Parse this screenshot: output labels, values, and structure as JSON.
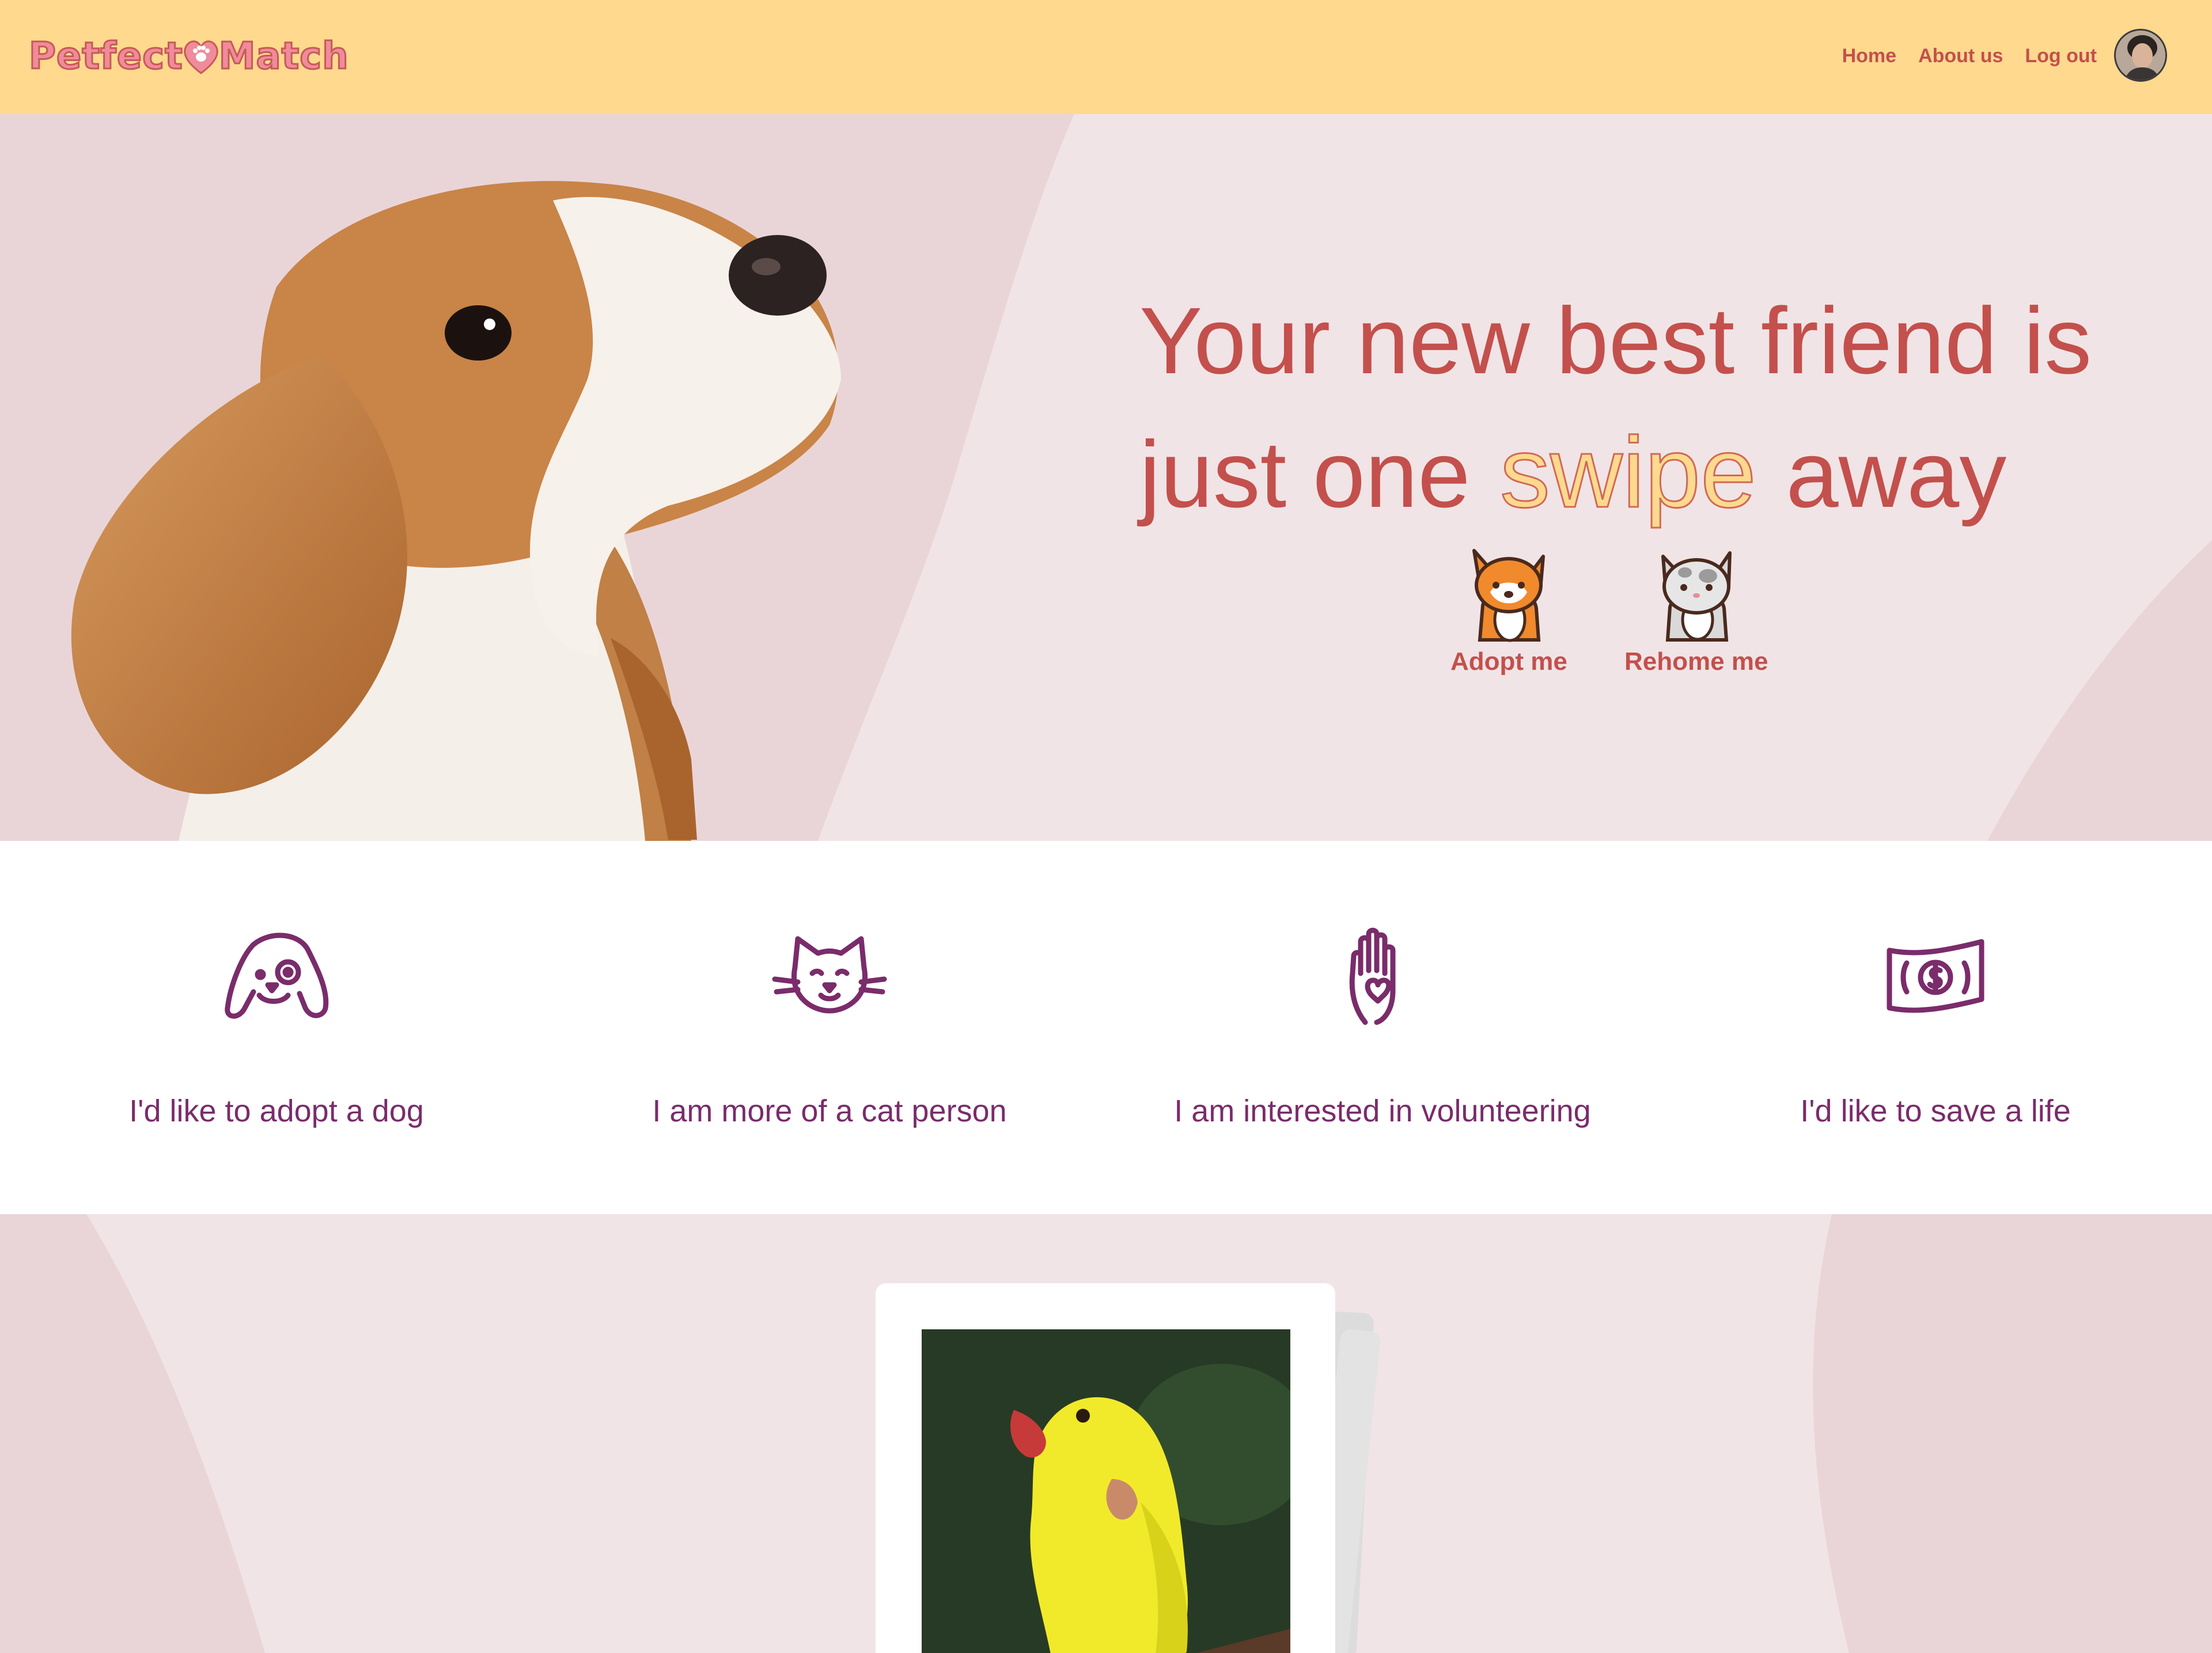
{
  "app": {
    "logo_text_left": "Petfect",
    "logo_text_right": "Match",
    "brand_color": "#c3504c",
    "nav_background": "#ffd98e",
    "accent_purple": "#7a2c6b"
  },
  "nav": {
    "items": [
      {
        "label": "Home"
      },
      {
        "label": "About us"
      },
      {
        "label": "Log out"
      }
    ],
    "avatar_icon": "user-avatar"
  },
  "hero": {
    "headline_part1": "Your new best friend is just one",
    "headline_highlight": "swipe",
    "headline_part2": "away",
    "actions": [
      {
        "label": "Adopt me",
        "icon": "corgi-dog-icon"
      },
      {
        "label": "Rehome me",
        "icon": "cat-icon"
      }
    ]
  },
  "features": [
    {
      "label": "I'd like to adopt a dog",
      "icon": "dog-face-icon"
    },
    {
      "label": "I am more of a cat person",
      "icon": "cat-face-icon"
    },
    {
      "label": "I am interested in volunteering",
      "icon": "hand-heart-icon"
    },
    {
      "label": "I'd like to save a life",
      "icon": "money-bill-icon"
    }
  ],
  "card": {
    "photo_icon": "yellow-parrot-photo"
  }
}
